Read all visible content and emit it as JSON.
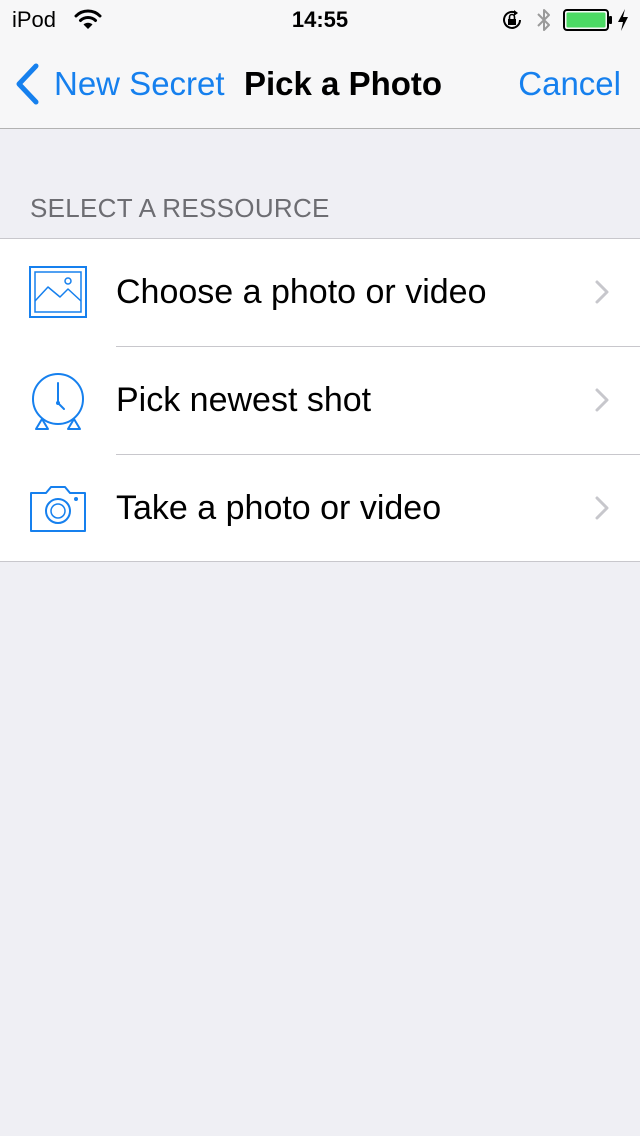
{
  "status_bar": {
    "carrier": "iPod",
    "time": "14:55",
    "battery_color": "#4cd964"
  },
  "nav": {
    "back_label": "New Secret",
    "title": "Pick a Photo",
    "cancel_label": "Cancel",
    "tint_color": "#1680ee"
  },
  "section": {
    "header": "SELECT A RESSOURCE",
    "items": [
      {
        "label": "Choose a photo or video",
        "icon": "photo-icon"
      },
      {
        "label": "Pick newest shot",
        "icon": "clock-icon"
      },
      {
        "label": "Take a photo or video",
        "icon": "camera-icon"
      }
    ]
  }
}
